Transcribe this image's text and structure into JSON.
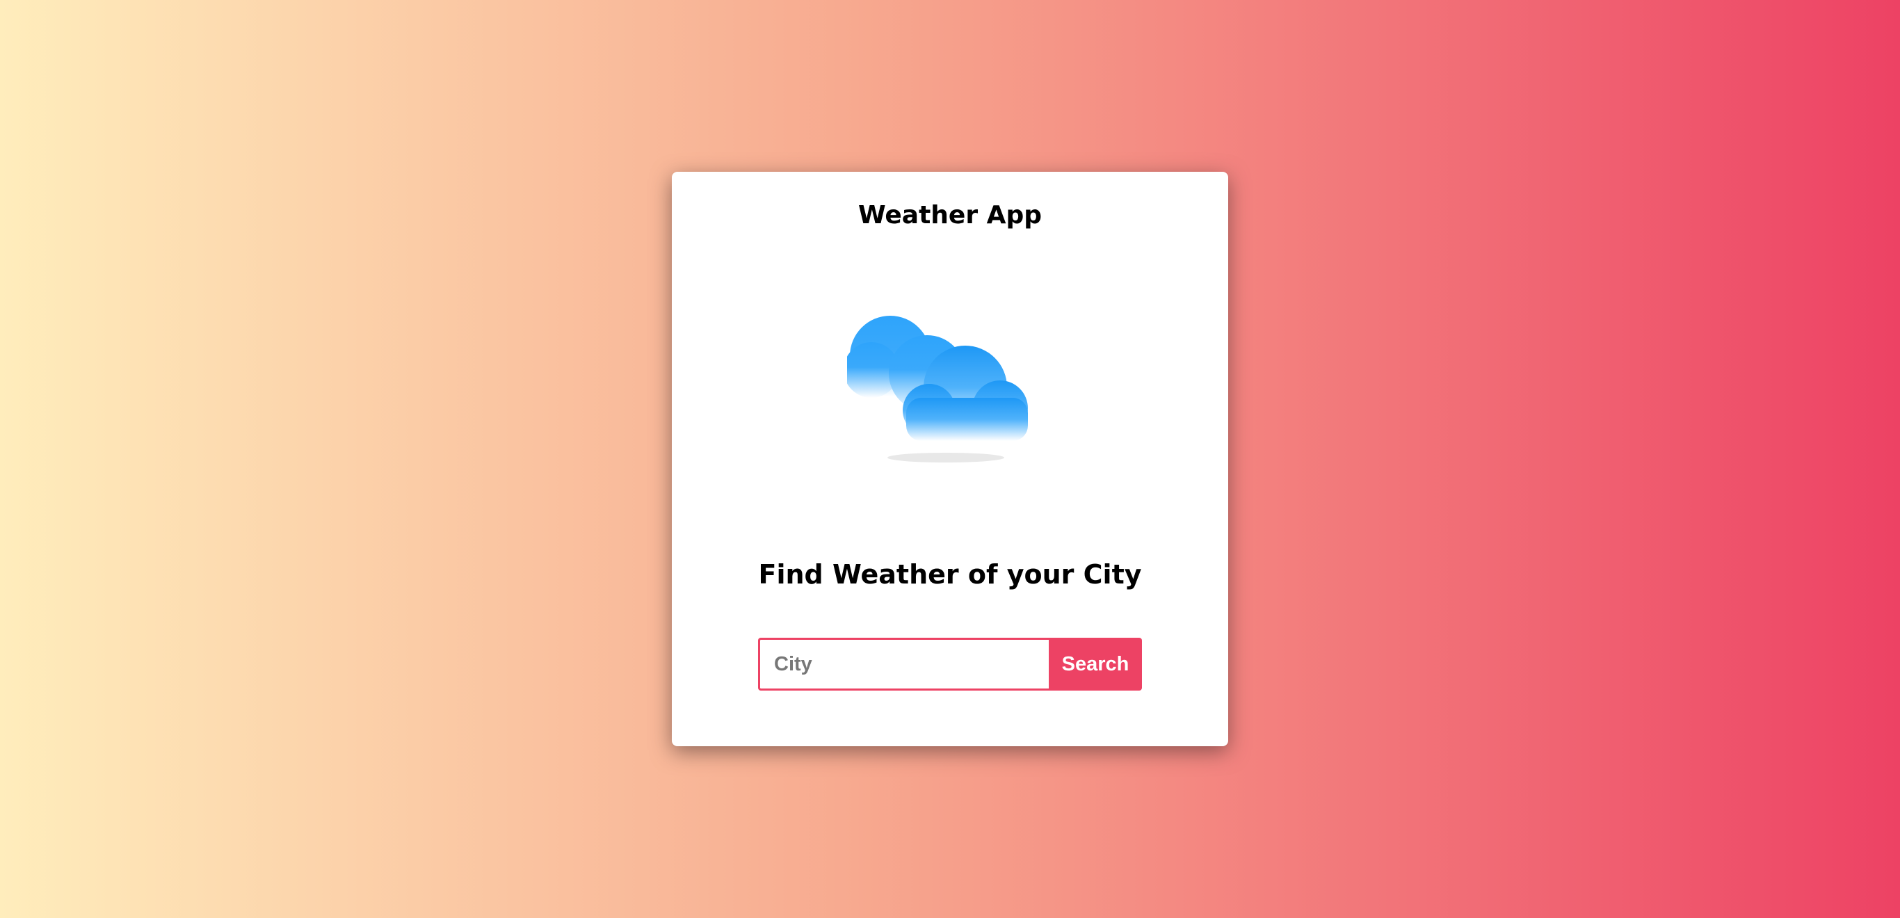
{
  "app": {
    "title": "Weather App",
    "subtitle": "Find Weather of your City"
  },
  "search": {
    "placeholder": "City",
    "value": "",
    "button_label": "Search"
  },
  "illustration": {
    "icon": "cloud-icon"
  },
  "colors": {
    "accent": "#ed4264",
    "gradient_start": "#ffedbc",
    "gradient_end": "#ed4264",
    "cloud_blue": "#2ea4fb"
  }
}
